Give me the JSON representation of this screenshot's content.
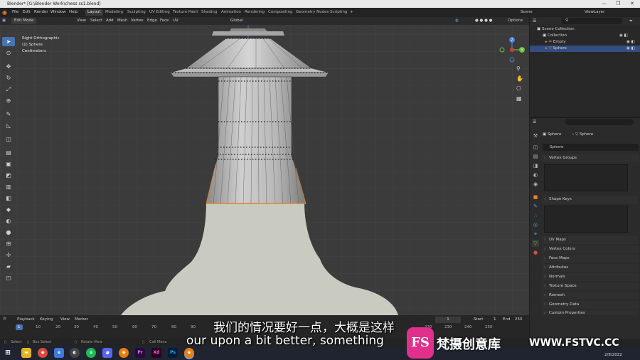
{
  "window": {
    "title": "Blender* [G:\\Blender Work\\chess ss1.blend]",
    "controls": [
      "—",
      "❐",
      "✕"
    ]
  },
  "menu": {
    "items": [
      "File",
      "Edit",
      "Render",
      "Window",
      "Help"
    ],
    "workspaces": [
      "Layout",
      "Modeling",
      "Sculpting",
      "UV Editing",
      "Texture Paint",
      "Shading",
      "Animation",
      "Rendering",
      "Compositing",
      "Geometry Nodes",
      "Scripting",
      "+"
    ],
    "scene": "Scene",
    "view_layer": "ViewLayer"
  },
  "viewport_header": {
    "mode": "Edit Mode",
    "menus": [
      "View",
      "Select",
      "Add",
      "Mesh",
      "Vertex",
      "Edge",
      "Face",
      "UV"
    ],
    "orientation": "Global",
    "options": "Options"
  },
  "viewport_info": {
    "view": "Right Orthographic",
    "object": "(1) Sphere",
    "units": "Centimeters"
  },
  "gizmo": {
    "z": "Z",
    "y": "Y"
  },
  "outliner": {
    "scene_collection": "Scene Collection",
    "collection": "Collection",
    "objects": [
      "Empty",
      "Sphere"
    ]
  },
  "properties": {
    "object_name": "Sphere",
    "mesh_name": "Sphere",
    "data_name": "Sphere",
    "panels": [
      "Vertex Groups",
      "Shape Keys",
      "UV Maps",
      "Vertex Colors",
      "Face Maps",
      "Attributes",
      "Normals",
      "Texture Space",
      "Remesh",
      "Geometry Data",
      "Custom Properties"
    ]
  },
  "timeline": {
    "menus": [
      "Playback",
      "Keying",
      "View",
      "Marker"
    ],
    "current_frame": "1",
    "start_label": "Start",
    "start": "1",
    "end_label": "End",
    "end": "250",
    "frames": [
      "1",
      "10",
      "20",
      "30",
      "40",
      "50",
      "60",
      "70",
      "80",
      "90",
      "220",
      "230",
      "240",
      "250"
    ]
  },
  "status": {
    "select": "Select",
    "box_select": "Box Select",
    "rotate": "Rotate View",
    "call_menu": "Call Menu"
  },
  "taskbar": {
    "date": "2/8/2022"
  },
  "subtitles": {
    "cn": "我们的情况要好一点，大概是这样",
    "en": "our upon a bit better, something"
  },
  "watermark": {
    "logo": "FS",
    "text": "梵摄创意库",
    "url": "WWW.FSTVC.CC"
  },
  "colors": {
    "accent": "#4772b3",
    "selected_edge": "#e8812a",
    "viewport_bg": "#3b3b3b",
    "watermark": "#e0308c"
  }
}
